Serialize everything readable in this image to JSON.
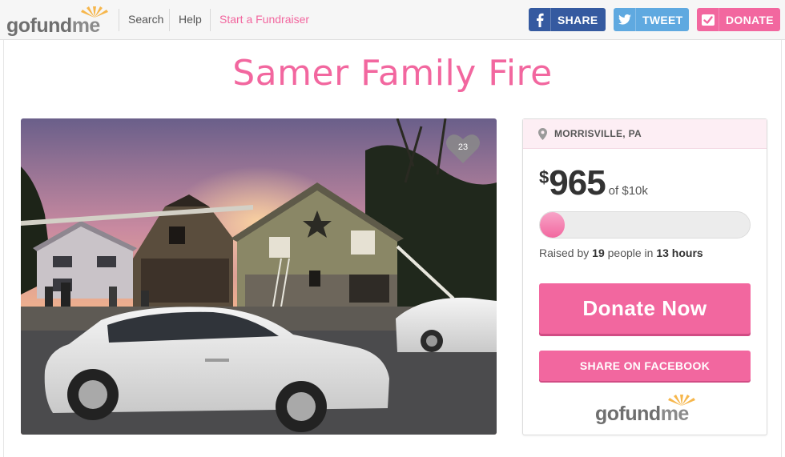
{
  "nav": {
    "logo_go": "go",
    "logo_fund": "fund",
    "logo_me": "me",
    "search": "Search",
    "help": "Help",
    "start": "Start a Fundraiser",
    "share": "SHARE",
    "tweet": "TWEET",
    "donate": "DONATE"
  },
  "campaign": {
    "title": "Samer Family Fire",
    "hearts": "23",
    "location": "MORRISVILLE, PA",
    "currency": "$",
    "raised": "965",
    "goal": "of $10k",
    "progress_fraction": 0.0965,
    "raised_by_prefix": "Raised by ",
    "people": "19",
    "raised_by_mid": " people in ",
    "hours": "13 hours",
    "donate_now": "Donate Now",
    "share_facebook": "SHARE ON FACEBOOK"
  },
  "colors": {
    "brand_pink": "#f2679f",
    "facebook_blue": "#355aa0",
    "twitter_blue": "#5fa9e0"
  }
}
